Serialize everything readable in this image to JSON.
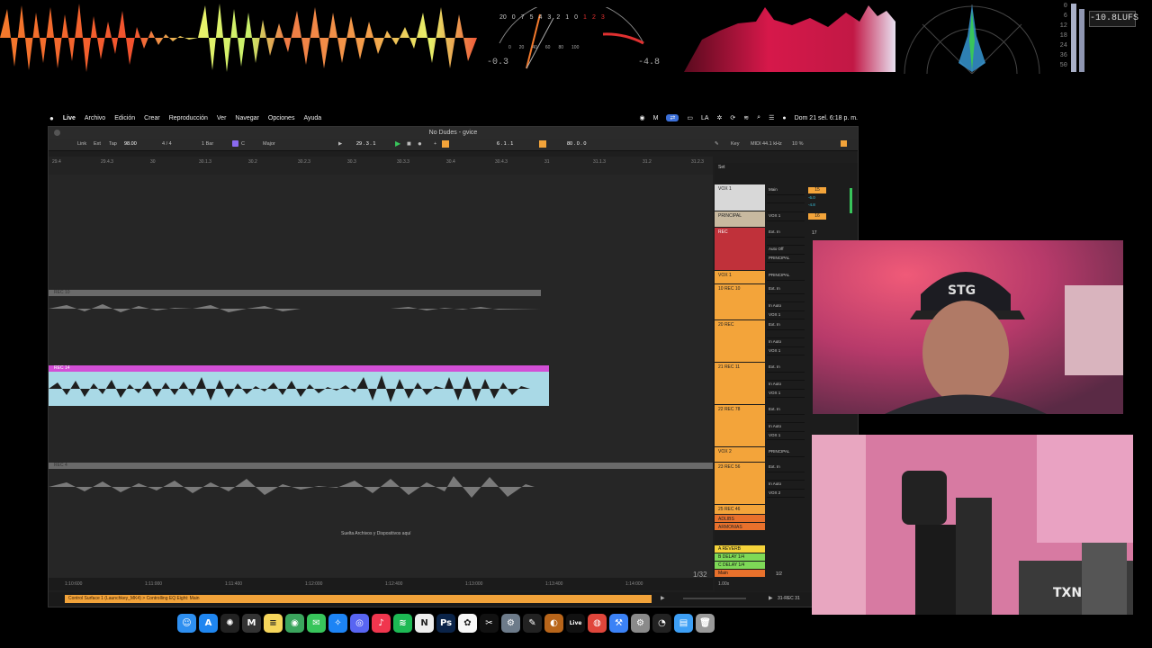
{
  "meters": {
    "vu_left_readout": "-0.3",
    "vu_right_readout": "-4.8",
    "vu_scale_top": [
      "20",
      "0",
      "7",
      "5",
      "4",
      "3",
      "2",
      "1",
      "0",
      "1",
      "2",
      "3"
    ],
    "vu_scale_bottom": [
      "0",
      "20",
      "40",
      "60",
      "80",
      "100"
    ],
    "lufs_readout": "-10.8LUFS",
    "lufs_scale": [
      "0",
      "6",
      "12",
      "18",
      "24",
      "36",
      "50"
    ]
  },
  "menubar": {
    "apple": "",
    "app_name": "Live",
    "items": [
      "Archivo",
      "Edición",
      "Crear",
      "Reproducción",
      "Ver",
      "Navegar",
      "Opciones",
      "Ayuda"
    ],
    "lang": "LA",
    "clock": "Dom 21 sel. 6:18 p. m."
  },
  "window": {
    "title": "No Dudes - gvice"
  },
  "controlbar": {
    "link": "Link",
    "ext": "Ext",
    "tap": "Tap",
    "tempo": "98.00",
    "signature": "4 / 4",
    "quantize": "1 Bar",
    "key": "C",
    "scale": "Major",
    "position": "29 .  3 .  1",
    "loop_start": "6 .  1 .  1",
    "loop_len": "80 .  0 .  0",
    "key_label": "Key",
    "midi_label": "MIDI",
    "sample_rate": "44.1 kHz",
    "cpu": "10 %"
  },
  "ruler_ticks": [
    "29.4",
    "29.4.3",
    "30",
    "30.1.3",
    "30.2",
    "30.2.3",
    "30.3",
    "30.3.3",
    "30.4",
    "30.4.3",
    "31",
    "31.1.3",
    "31.2",
    "31.2.3"
  ],
  "time_ticks": [
    "1:10:600",
    "1:11:000",
    "1:11:400",
    "1:12:000",
    "1:12:400",
    "1:13:000",
    "1:13:400",
    "1:14:000"
  ],
  "zoom_fraction": "1/32",
  "arrangement": {
    "clip1_name": "REC 10",
    "clip2_name": "REC 14",
    "clip3_name": "REC 4",
    "drop_hint": "Suelta Archivos y Dispositivos aquí"
  },
  "mixer": {
    "set_label": "Set",
    "tracks": [
      {
        "name": "VOX 1",
        "color": "#d8d8d8"
      },
      {
        "name": "PRINCIPAL",
        "color": "#c8b9a0"
      },
      {
        "name": "REC",
        "color": "#c0313a"
      },
      {
        "name": "VOX 1",
        "color": "#f3a43a"
      },
      {
        "name": "10 REC 10",
        "color": "#f3a43a"
      },
      {
        "name": "20 REC",
        "color": "#f3a43a"
      },
      {
        "name": "21 REC 11",
        "color": "#f3a43a"
      },
      {
        "name": "22 REC 78",
        "color": "#f3a43a"
      },
      {
        "name": "VOX 2",
        "color": "#f3a43a"
      },
      {
        "name": "23 REC 56",
        "color": "#f3a43a"
      },
      {
        "name": "25 REC 46",
        "color": "#f3a43a"
      },
      {
        "name": "ADLIBS",
        "color": "#e8712c"
      },
      {
        "name": "ARMONIAS",
        "color": "#e8712c"
      }
    ],
    "io_main": "Main",
    "io_vox": "VOX 1",
    "io_extin": "Ext. In",
    "io_principal": "PRINCIPAL",
    "io_auto": "Auto",
    "io_off": "Off",
    "io_in": "In",
    "io_vox2": "VOX 2",
    "vol_15": "15",
    "vol_16": "16",
    "vol_17": "17",
    "val_m6": "-6.0",
    "val_m48": "-4.8",
    "returns": [
      {
        "name": "A REVERB",
        "color": "#f5d33a"
      },
      {
        "name": "B DELAY 1/4",
        "color": "#7ed957"
      },
      {
        "name": "C DELAY 1/4",
        "color": "#7ed957"
      },
      {
        "name": "Main",
        "color": "#e8712c"
      }
    ],
    "main_fraction": "1/2",
    "zoom": "1.00x"
  },
  "status": {
    "text": "Control Surface 1 (Launchkey_MK4) > Controlling EQ Eight: Main",
    "position": "31-REC 31"
  },
  "dock": {
    "icons": [
      {
        "name": "finder-icon",
        "color": "#2e8ff0",
        "glyph": "☺"
      },
      {
        "name": "app-store-icon",
        "color": "#1f86f0",
        "glyph": "A"
      },
      {
        "name": "chatgpt-icon",
        "color": "#222",
        "glyph": "✺"
      },
      {
        "name": "logic-icon",
        "color": "#333",
        "glyph": "M"
      },
      {
        "name": "notes-icon",
        "color": "#f5d55b",
        "glyph": "≡"
      },
      {
        "name": "chrome-profile-icon",
        "color": "#3ba55d",
        "glyph": "◉"
      },
      {
        "name": "messages-icon",
        "color": "#38c55b",
        "glyph": "✉"
      },
      {
        "name": "safari-icon",
        "color": "#1d84f5",
        "glyph": "✧"
      },
      {
        "name": "discord-icon",
        "color": "#5865f2",
        "glyph": "◎"
      },
      {
        "name": "music-icon",
        "color": "#f0364e",
        "glyph": "♪"
      },
      {
        "name": "spotify-icon",
        "color": "#1db954",
        "glyph": "≋"
      },
      {
        "name": "notion-icon",
        "color": "#eee",
        "glyph": "N"
      },
      {
        "name": "photoshop-icon",
        "color": "#0a2348",
        "glyph": "Ps"
      },
      {
        "name": "photos-icon",
        "color": "#f6f6f6",
        "glyph": "✿"
      },
      {
        "name": "capcut-icon",
        "color": "#111",
        "glyph": "✂"
      },
      {
        "name": "automator-icon",
        "color": "#6d7b8a",
        "glyph": "⚙"
      },
      {
        "name": "pen-tool-icon",
        "color": "#222",
        "glyph": "✎"
      },
      {
        "name": "audition-icon",
        "color": "#b8651a",
        "glyph": "◐"
      },
      {
        "name": "ableton-live-icon",
        "color": "#111",
        "glyph": "Live"
      },
      {
        "name": "chrome-icon",
        "color": "#e0463b",
        "glyph": "◍"
      },
      {
        "name": "xcode-icon",
        "color": "#3b82f6",
        "glyph": "⚒"
      },
      {
        "name": "system-settings-icon",
        "color": "#8a8a8a",
        "glyph": "⚙"
      },
      {
        "name": "activity-monitor-icon",
        "color": "#222",
        "glyph": "◔"
      },
      {
        "name": "downloads-folder-icon",
        "color": "#3d9ff5",
        "glyph": "▤"
      },
      {
        "name": "trash-icon",
        "color": "#9a9a9a",
        "glyph": "🗑"
      }
    ]
  }
}
